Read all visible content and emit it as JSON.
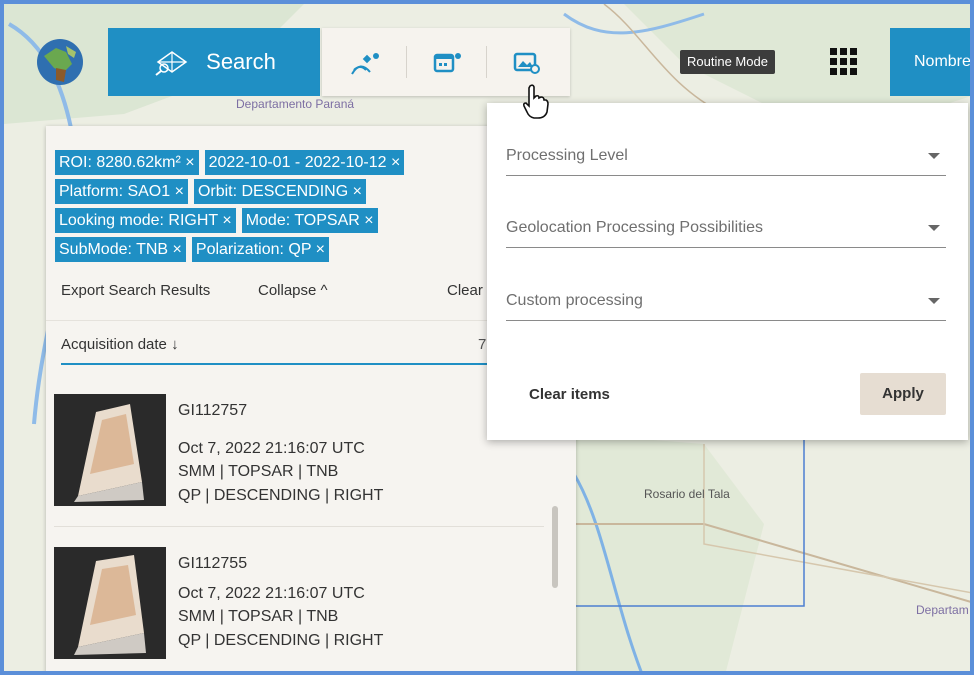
{
  "header": {
    "search_label": "Search",
    "routine_mode": "Routine Mode",
    "user_label": "Nombre"
  },
  "map": {
    "labels": [
      "Departamento Paraná",
      "Rosario del Tala",
      "Departam Urugua"
    ]
  },
  "filters": {
    "tags": [
      "ROI: 8280.62km² ×",
      "2022-10-01 - 2022-10-12 ×",
      "Platform: SAO1 ×",
      "Orbit: DESCENDING ×",
      "Looking mode: RIGHT ×",
      "Mode: TOPSAR ×",
      "SubMode: TNB ×",
      "Polarization: QP ×"
    ],
    "export_label": "Export Search Results",
    "collapse_label": "Collapse ^",
    "clear_label": "Clear"
  },
  "results": {
    "sort_label": "Acquisition date ↓",
    "count_fragment": "7",
    "items": [
      {
        "id": "GI112757",
        "datetime": "Oct 7, 2022 21:16:07 UTC",
        "line2": "SMM | TOPSAR | TNB",
        "line3": "QP | DESCENDING | RIGHT"
      },
      {
        "id": "GI112755",
        "datetime": "Oct 7, 2022 21:16:07 UTC",
        "line2": "SMM | TOPSAR | TNB",
        "line3": "QP | DESCENDING | RIGHT"
      }
    ]
  },
  "processing_panel": {
    "fields": [
      "Processing Level",
      "Geolocation Processing Possibilities",
      "Custom processing"
    ],
    "clear_items_label": "Clear items",
    "apply_label": "Apply"
  },
  "colors": {
    "accent": "#1f8fc4",
    "frame": "#5b8fd9",
    "apply_bg": "#e6ddd2"
  },
  "icons": [
    "satellite-icon",
    "calendar-icon",
    "image-settings-icon",
    "apps-grid-icon",
    "search-constellation-icon",
    "hand-cursor-icon"
  ]
}
